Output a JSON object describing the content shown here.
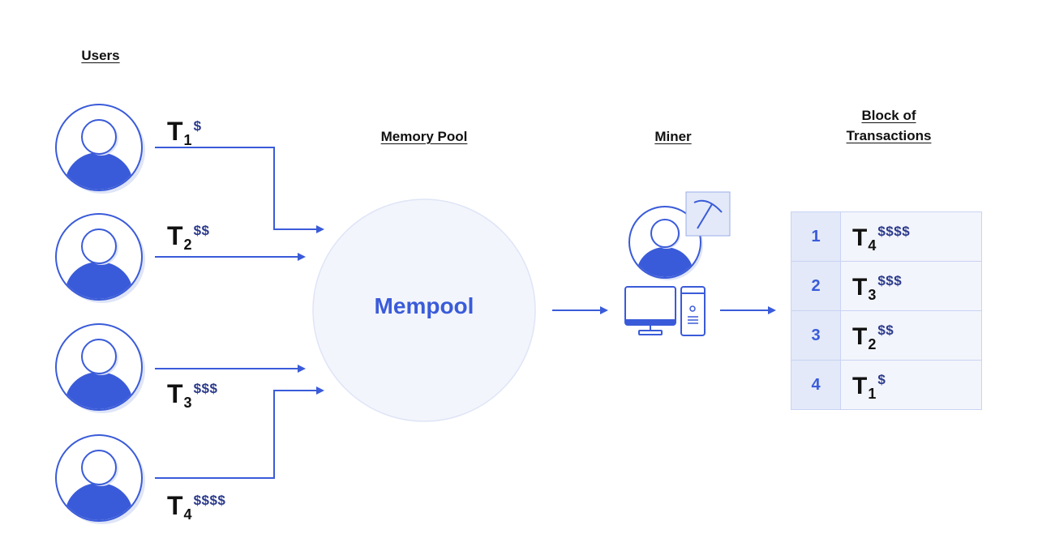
{
  "headings": {
    "users": "Users",
    "memory_pool": "Memory Pool",
    "miner": "Miner",
    "block_line1": "Block of",
    "block_line2": "Transactions"
  },
  "mempool": {
    "label": "Mempool"
  },
  "colors": {
    "accent": "#3a5bd9",
    "accent_light": "#e3e9f8",
    "fee_dark": "#2b3a8c",
    "text": "#111111"
  },
  "users": [
    {
      "icon": "user-icon",
      "tx": {
        "letter": "T",
        "index": "1",
        "fee": "$"
      }
    },
    {
      "icon": "user-icon",
      "tx": {
        "letter": "T",
        "index": "2",
        "fee": "$$"
      }
    },
    {
      "icon": "user-icon",
      "tx": {
        "letter": "T",
        "index": "3",
        "fee": "$$$"
      }
    },
    {
      "icon": "user-icon",
      "tx": {
        "letter": "T",
        "index": "4",
        "fee": "$$$$"
      }
    }
  ],
  "miner": {
    "icons": [
      "user-icon",
      "pickaxe-icon",
      "monitor-icon",
      "computer-tower-icon"
    ]
  },
  "block": {
    "rows": [
      {
        "num": "1",
        "letter": "T",
        "index": "4",
        "fee": "$$$$"
      },
      {
        "num": "2",
        "letter": "T",
        "index": "3",
        "fee": "$$$"
      },
      {
        "num": "3",
        "letter": "T",
        "index": "2",
        "fee": "$$"
      },
      {
        "num": "4",
        "letter": "T",
        "index": "1",
        "fee": "$"
      }
    ]
  }
}
